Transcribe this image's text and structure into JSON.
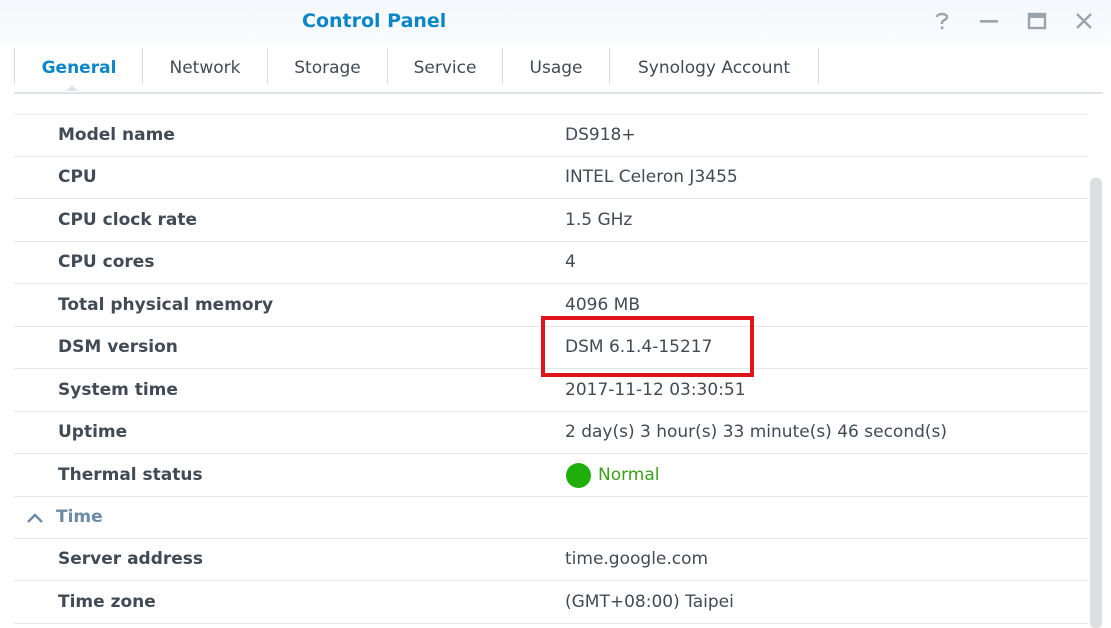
{
  "window": {
    "title": "Control Panel",
    "buttons": [
      "help-icon",
      "minimize-icon",
      "maximize-icon",
      "close-icon"
    ]
  },
  "tabs": [
    {
      "label": "General",
      "active": true
    },
    {
      "label": "Network",
      "active": false
    },
    {
      "label": "Storage",
      "active": false
    },
    {
      "label": "Service",
      "active": false
    },
    {
      "label": "Usage",
      "active": false
    },
    {
      "label": "Synology Account",
      "active": false
    }
  ],
  "info": {
    "rows": [
      {
        "label": "Model name",
        "value": "DS918+"
      },
      {
        "label": "CPU",
        "value": "INTEL Celeron J3455"
      },
      {
        "label": "CPU clock rate",
        "value": "1.5 GHz"
      },
      {
        "label": "CPU cores",
        "value": "4"
      },
      {
        "label": "Total physical memory",
        "value": "4096 MB"
      },
      {
        "label": "DSM version",
        "value": "DSM 6.1.4-15217"
      },
      {
        "label": "System time",
        "value": "2017-11-12 03:30:51"
      },
      {
        "label": "Uptime",
        "value": "2 day(s) 3 hour(s) 33 minute(s) 46 second(s)"
      }
    ],
    "thermal": {
      "label": "Thermal status",
      "value": "Normal"
    }
  },
  "time_section": {
    "title": "Time",
    "rows": [
      {
        "label": "Server address",
        "value": "time.google.com"
      },
      {
        "label": "Time zone",
        "value": "(GMT+08:00) Taipei"
      }
    ]
  },
  "colors": {
    "accent": "#0b86c9",
    "status_ok": "#1fae0c",
    "highlight": "#e0151b"
  }
}
